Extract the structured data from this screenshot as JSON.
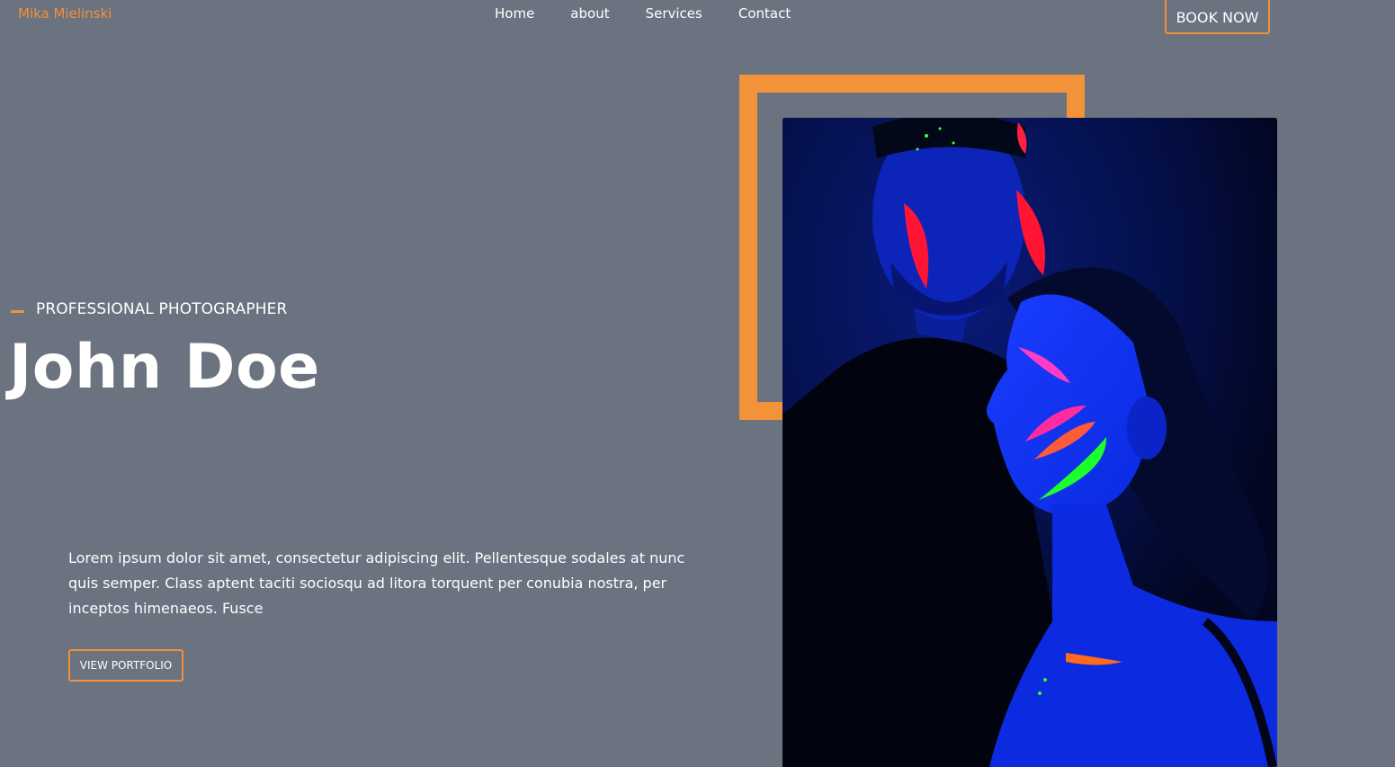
{
  "header": {
    "brand": "Mika Mielinski",
    "nav": [
      "Home",
      "about",
      "Services",
      "Contact"
    ],
    "cta": "BOOK NOW"
  },
  "hero": {
    "subtitle": "PROFESSIONAL PHOTOGRAPHER",
    "title": "John Doe",
    "description": "Lorem ipsum dolor sit amet, consectetur adipiscing elit. Pellentesque sodales at nunc quis semper. Class aptent taciti sociosqu ad litora torquent per conubia nostra, per inceptos himenaeos. Fusce",
    "button": "VIEW PORTFOLIO",
    "image_icon": "neon-portrait-photo"
  },
  "colors": {
    "background": "#6b7280",
    "accent": "#f39238",
    "text": "#ffffff"
  }
}
